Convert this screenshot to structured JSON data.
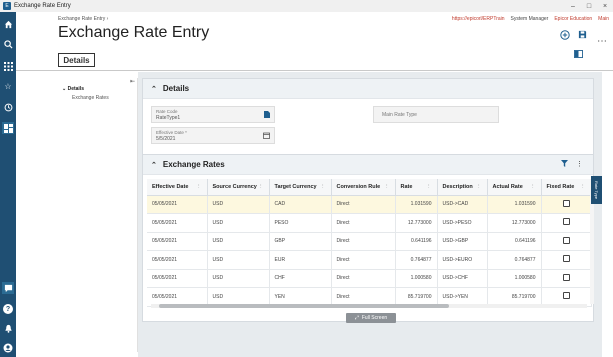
{
  "window": {
    "title": "Exchange Rate Entry",
    "controls": [
      "–",
      "□",
      "×"
    ]
  },
  "breadcrumb": "Exchange Rate Entry  ›",
  "top_links": {
    "url": "https://epicorl/ERPTrain",
    "role": "System Manager",
    "company": "Epicor Education",
    "site": "Main"
  },
  "page_title": "Exchange Rate Entry",
  "tab": "Details",
  "nav": {
    "main": "Details",
    "sub": "Exchange Rates"
  },
  "details": {
    "header": "Details",
    "rate_code_label": "Rate Code",
    "rate_code_value": "RateType1",
    "effective_date_label": "Effective Date *",
    "effective_date_value": "5/5/2021",
    "rate_type_label": "Main Rate Type"
  },
  "rates": {
    "header": "Exchange Rates",
    "columns": [
      "Effective Date",
      "Source Currency",
      "Target Currency",
      "Conversion Rule",
      "Rate",
      "Description",
      "Actual Rate",
      "Fixed Rate"
    ],
    "rows": [
      [
        "05/05/2021",
        "USD",
        "CAD",
        "Direct",
        "1.031590",
        "USD->CAD",
        "1.031590"
      ],
      [
        "05/05/2021",
        "USD",
        "PESO",
        "Direct",
        "12.773000",
        "USD->PESO",
        "12.773000"
      ],
      [
        "05/05/2021",
        "USD",
        "GBP",
        "Direct",
        "0.641196",
        "USD->GBP",
        "0.641196"
      ],
      [
        "05/05/2021",
        "USD",
        "EUR",
        "Direct",
        "0.764877",
        "USD->EURO",
        "0.764877"
      ],
      [
        "05/05/2021",
        "USD",
        "CHF",
        "Direct",
        "1.000580",
        "USD->CHF",
        "1.000580"
      ],
      [
        "05/05/2021",
        "USD",
        "YEN",
        "Direct",
        "85.719700",
        "USD->YEN",
        "85.719700"
      ]
    ]
  },
  "full_screen_label": "Full Screen",
  "side_tab_label": "Rate Type",
  "icons": {
    "rail": [
      "home-icon",
      "search-icon",
      "apps-grid-icon",
      "star-icon",
      "history-icon",
      "dashboard-icon",
      "chat-icon",
      "help-icon",
      "notification-icon",
      "user-icon"
    ]
  },
  "colors": {
    "rail": "#1f4f73",
    "accent": "#1f5f8f",
    "selected_row": "#fdf8df",
    "link": "#c0392b"
  }
}
